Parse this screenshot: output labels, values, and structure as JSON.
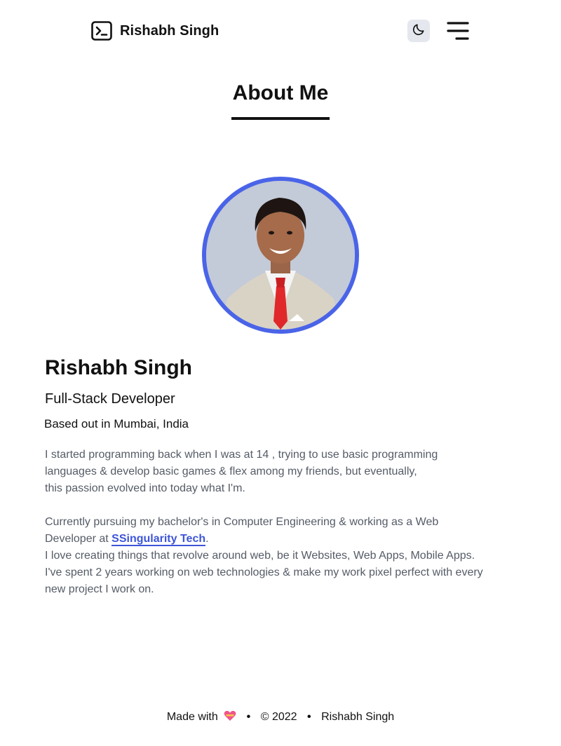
{
  "header": {
    "brand_name": "Rishabh Singh",
    "brand_icon": "terminal-icon",
    "theme_icon": "moon-icon",
    "menu_icon": "hamburger-menu-icon"
  },
  "about": {
    "title": "About Me",
    "name": "Rishabh Singh",
    "role": "Full-Stack Developer",
    "location": "Based out in Mumbai, India",
    "bio_line1": "I started programming back when I was at 14 , trying to use basic programming",
    "bio_line2": "languages & develop basic games & flex among my friends, but eventually,",
    "bio_line3": "this passion evolved into today what I'm.",
    "bio2_line1": "Currently pursuing my bachelor's in Computer Engineering & working as a Web",
    "bio2_line2_prefix": "Developer at ",
    "company_link": "SSingularity Tech",
    "bio2_line2_suffix": ".",
    "bio2_line3": "I love creating things that revolve around web, be it Websites, Web Apps, Mobile Apps.",
    "bio2_line4": "I've spent 2 years working on web technologies & make my work pixel perfect with every",
    "bio2_line5": "new project I work on."
  },
  "footer": {
    "made_with": "Made with",
    "copyright": "© 2022",
    "author": "Rishabh Singh"
  },
  "colors": {
    "accent": "#4a64e8",
    "link": "#3d55d8",
    "text_muted": "#555b66",
    "toggle_bg": "#e4e7ee"
  }
}
